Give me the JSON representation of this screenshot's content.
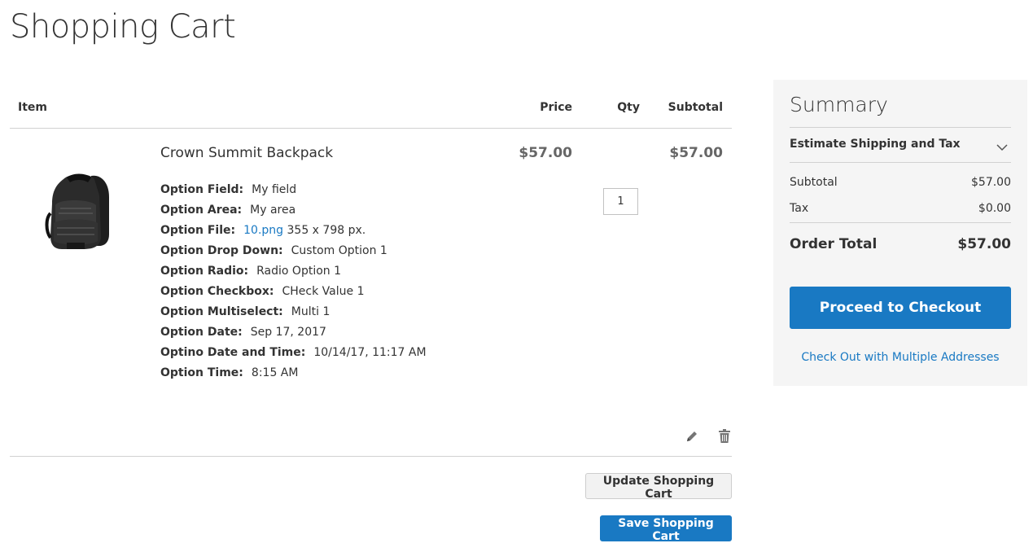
{
  "page": {
    "title": "Shopping Cart"
  },
  "cart": {
    "headers": {
      "item": "Item",
      "price": "Price",
      "qty": "Qty",
      "subtotal": "Subtotal"
    },
    "item": {
      "name": "Crown Summit Backpack",
      "image_icon": "backpack-product-image",
      "price": "$57.00",
      "qty": "1",
      "subtotal": "$57.00",
      "options": [
        {
          "label": "Option Field:",
          "value": "My field"
        },
        {
          "label": "Option Area:",
          "value": "My area"
        },
        {
          "label": "Option File:",
          "link": "10.png",
          "value": " 355 x 798 px."
        },
        {
          "label": "Option Drop Down:",
          "value": "Custom Option 1"
        },
        {
          "label": "Option Radio:",
          "value": "Radio Option 1"
        },
        {
          "label": "Option Checkbox:",
          "value": "CHeck Value 1"
        },
        {
          "label": "Option Multiselect:",
          "value": "Multi 1"
        },
        {
          "label": "Option Date:",
          "value": "Sep 17, 2017"
        },
        {
          "label": "Optino Date and Time:",
          "value": "10/14/17, 11:17 AM"
        },
        {
          "label": "Option Time:",
          "value": "8:15 AM"
        }
      ],
      "actions": {
        "edit_icon": "pencil-icon",
        "delete_icon": "trash-icon"
      }
    },
    "update_button": "Update Shopping Cart",
    "save_button": "Save Shopping Cart"
  },
  "summary": {
    "title": "Summary",
    "estimate_label": "Estimate Shipping and Tax",
    "subtotal_label": "Subtotal",
    "subtotal_value": "$57.00",
    "tax_label": "Tax",
    "tax_value": "$0.00",
    "order_total_label": "Order Total",
    "order_total_value": "$57.00",
    "checkout_button": "Proceed to Checkout",
    "multi_address_link": "Check Out with Multiple Addresses"
  },
  "colors": {
    "accent": "#1979c3",
    "summary_bg": "#f5f5f5",
    "text": "#333333"
  }
}
